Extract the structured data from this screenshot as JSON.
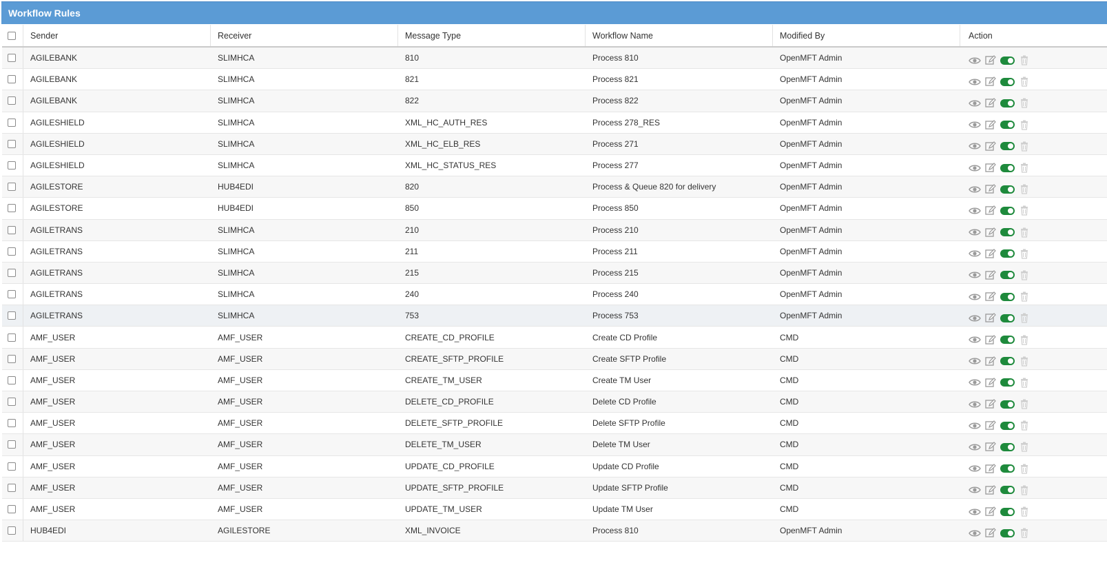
{
  "window": {
    "title": "Workflow Rules"
  },
  "columns": {
    "sender": "Sender",
    "receiver": "Receiver",
    "message_type": "Message Type",
    "workflow_name": "Workflow Name",
    "modified_by": "Modified By",
    "action": "Action"
  },
  "icons": [
    "view-eye-icon",
    "edit-pencil-icon",
    "enable-toggle",
    "delete-trash-icon"
  ],
  "colors": {
    "header_bg": "#5B9BD5",
    "toggle_on": "#1e8a3c",
    "icon": "#9a9a9a"
  },
  "rows": [
    {
      "sender": "AGILEBANK",
      "receiver": "SLIMHCA",
      "message_type": "810",
      "workflow_name": "Process 810",
      "modified_by": "OpenMFT Admin"
    },
    {
      "sender": "AGILEBANK",
      "receiver": "SLIMHCA",
      "message_type": "821",
      "workflow_name": "Process 821",
      "modified_by": "OpenMFT Admin"
    },
    {
      "sender": "AGILEBANK",
      "receiver": "SLIMHCA",
      "message_type": "822",
      "workflow_name": "Process 822",
      "modified_by": "OpenMFT Admin"
    },
    {
      "sender": "AGILESHIELD",
      "receiver": "SLIMHCA",
      "message_type": "XML_HC_AUTH_RES",
      "workflow_name": "Process 278_RES",
      "modified_by": "OpenMFT Admin"
    },
    {
      "sender": "AGILESHIELD",
      "receiver": "SLIMHCA",
      "message_type": "XML_HC_ELB_RES",
      "workflow_name": "Process 271",
      "modified_by": "OpenMFT Admin"
    },
    {
      "sender": "AGILESHIELD",
      "receiver": "SLIMHCA",
      "message_type": "XML_HC_STATUS_RES",
      "workflow_name": "Process 277",
      "modified_by": "OpenMFT Admin"
    },
    {
      "sender": "AGILESTORE",
      "receiver": "HUB4EDI",
      "message_type": "820",
      "workflow_name": "Process & Queue 820 for delivery",
      "modified_by": "OpenMFT Admin"
    },
    {
      "sender": "AGILESTORE",
      "receiver": "HUB4EDI",
      "message_type": "850",
      "workflow_name": "Process 850",
      "modified_by": "OpenMFT Admin"
    },
    {
      "sender": "AGILETRANS",
      "receiver": "SLIMHCA",
      "message_type": "210",
      "workflow_name": "Process 210",
      "modified_by": "OpenMFT Admin"
    },
    {
      "sender": "AGILETRANS",
      "receiver": "SLIMHCA",
      "message_type": "211",
      "workflow_name": "Process 211",
      "modified_by": "OpenMFT Admin"
    },
    {
      "sender": "AGILETRANS",
      "receiver": "SLIMHCA",
      "message_type": "215",
      "workflow_name": "Process 215",
      "modified_by": "OpenMFT Admin"
    },
    {
      "sender": "AGILETRANS",
      "receiver": "SLIMHCA",
      "message_type": "240",
      "workflow_name": "Process 240",
      "modified_by": "OpenMFT Admin"
    },
    {
      "sender": "AGILETRANS",
      "receiver": "SLIMHCA",
      "message_type": "753",
      "workflow_name": "Process 753",
      "modified_by": "OpenMFT Admin"
    },
    {
      "sender": "AMF_USER",
      "receiver": "AMF_USER",
      "message_type": "CREATE_CD_PROFILE",
      "workflow_name": "Create CD Profile",
      "modified_by": "CMD"
    },
    {
      "sender": "AMF_USER",
      "receiver": "AMF_USER",
      "message_type": "CREATE_SFTP_PROFILE",
      "workflow_name": "Create SFTP Profile",
      "modified_by": "CMD"
    },
    {
      "sender": "AMF_USER",
      "receiver": "AMF_USER",
      "message_type": "CREATE_TM_USER",
      "workflow_name": "Create TM User",
      "modified_by": "CMD"
    },
    {
      "sender": "AMF_USER",
      "receiver": "AMF_USER",
      "message_type": "DELETE_CD_PROFILE",
      "workflow_name": "Delete CD Profile",
      "modified_by": "CMD"
    },
    {
      "sender": "AMF_USER",
      "receiver": "AMF_USER",
      "message_type": "DELETE_SFTP_PROFILE",
      "workflow_name": "Delete SFTP Profile",
      "modified_by": "CMD"
    },
    {
      "sender": "AMF_USER",
      "receiver": "AMF_USER",
      "message_type": "DELETE_TM_USER",
      "workflow_name": "Delete TM User",
      "modified_by": "CMD"
    },
    {
      "sender": "AMF_USER",
      "receiver": "AMF_USER",
      "message_type": "UPDATE_CD_PROFILE",
      "workflow_name": "Update CD Profile",
      "modified_by": "CMD"
    },
    {
      "sender": "AMF_USER",
      "receiver": "AMF_USER",
      "message_type": "UPDATE_SFTP_PROFILE",
      "workflow_name": "Update SFTP Profile",
      "modified_by": "CMD"
    },
    {
      "sender": "AMF_USER",
      "receiver": "AMF_USER",
      "message_type": "UPDATE_TM_USER",
      "workflow_name": "Update TM User",
      "modified_by": "CMD"
    },
    {
      "sender": "HUB4EDI",
      "receiver": "AGILESTORE",
      "message_type": "XML_INVOICE",
      "workflow_name": "Process 810",
      "modified_by": "OpenMFT Admin"
    }
  ]
}
